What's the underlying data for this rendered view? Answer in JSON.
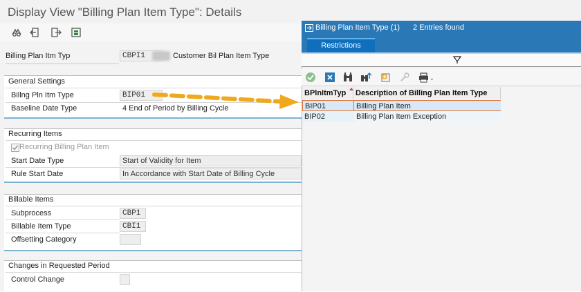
{
  "window": {
    "title": "Display View \"Billing Plan Item Type\": Details"
  },
  "toolbar": {
    "icons": [
      "glasses-icon",
      "previous-entry-icon",
      "next-entry-icon",
      "transport-icon"
    ]
  },
  "header_field": {
    "label": "Billing Plan Itm Typ",
    "code": "CBPI1",
    "description": "Customer Bil Plan Item Type"
  },
  "general_settings": {
    "title": "General Settings",
    "rows": [
      {
        "label": "Billng Pln Itm Type",
        "value": "BIP01"
      },
      {
        "label": "Baseline Date Type",
        "value": "4 End of Period by Billing Cycle"
      }
    ]
  },
  "recurring_items": {
    "title": "Recurring Items",
    "checkbox_label": "Recurring Billing Plan Item",
    "checked": true,
    "rows": [
      {
        "label": "Start Date Type",
        "value": "Start of Validity for Item"
      },
      {
        "label": "Rule Start Date",
        "value": "In Accordance with Start Date of Billing Cycle"
      }
    ]
  },
  "billable_items": {
    "title": "Billable Items",
    "rows": [
      {
        "label": "Subprocess",
        "value": "CBP1"
      },
      {
        "label": "Billable Item Type",
        "value": "CBI1"
      },
      {
        "label": "Offsetting Category",
        "value": ""
      }
    ]
  },
  "changes": {
    "title": "Changes in Requested Period",
    "rows": [
      {
        "label": "Control Change",
        "value": ""
      }
    ]
  },
  "dialog": {
    "title": "Billing Plan Item Type (1)",
    "count": "2 Entries found",
    "tab": "Restrictions",
    "columns": [
      "BPlnItmTyp",
      "Description of Billing Plan Item Type"
    ],
    "rows": [
      {
        "code": "BIP01",
        "description": "Billing Plan Item"
      },
      {
        "code": "BIP02",
        "description": "Billing Plan Item Exception"
      }
    ]
  },
  "colors": {
    "dialog_header": "#2b78b6",
    "tab_active": "#0f6fbd",
    "arrow": "#f0a81c",
    "selected_row": "#d9e8f6"
  }
}
